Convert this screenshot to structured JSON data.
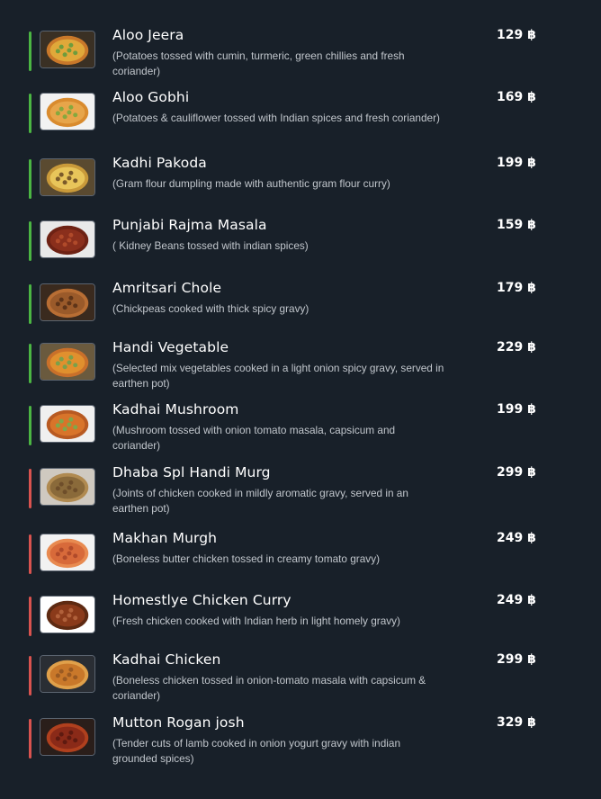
{
  "colors": {
    "background": "#182029",
    "veg": "#4bb543",
    "nonveg": "#d9534f"
  },
  "items": [
    {
      "name": "Aloo Jeera",
      "description": "(Potatoes tossed with cumin, turmeric, green chillies and fresh coriander)",
      "price": "129 ฿",
      "diet": "veg",
      "image": "aloo-jeera-photo"
    },
    {
      "name": "Aloo Gobhi",
      "description": "(Potatoes & cauliflower tossed with Indian spices and fresh coriander)",
      "price": "169 ฿",
      "diet": "veg",
      "image": "aloo-gobhi-photo"
    },
    {
      "name": "Kadhi Pakoda",
      "description": "(Gram flour dumpling made with authentic gram flour curry)",
      "price": "199 ฿",
      "diet": "veg",
      "image": "kadhi-pakoda-photo"
    },
    {
      "name": "Punjabi Rajma Masala",
      "description": "( Kidney Beans tossed with indian spices)",
      "price": "159 ฿",
      "diet": "veg",
      "image": "rajma-masala-photo"
    },
    {
      "name": "Amritsari Chole",
      "description": "(Chickpeas cooked with thick spicy gravy)",
      "price": "179 ฿",
      "diet": "veg",
      "image": "amritsari-chole-photo"
    },
    {
      "name": "Handi Vegetable",
      "description": "(Selected mix vegetables cooked in a light onion spicy gravy, served in earthen pot)",
      "price": "229 ฿",
      "diet": "veg",
      "image": "handi-vegetable-photo"
    },
    {
      "name": "Kadhai Mushroom",
      "description": "(Mushroom tossed with onion tomato masala, capsicum and coriander)",
      "price": "199 ฿",
      "diet": "veg",
      "image": "kadhai-mushroom-photo"
    },
    {
      "name": "Dhaba Spl Handi Murg",
      "description": "(Joints of chicken cooked in mildly aromatic gravy, served in an earthen pot)",
      "price": "299 ฿",
      "diet": "nonveg",
      "image": "handi-murg-photo"
    },
    {
      "name": "Makhan Murgh",
      "description": "(Boneless butter chicken tossed in creamy tomato gravy)",
      "price": "249 ฿",
      "diet": "nonveg",
      "image": "makhan-murgh-photo"
    },
    {
      "name": "Homestlye Chicken Curry",
      "description": "(Fresh chicken cooked with Indian herb in light homely gravy)",
      "price": "249 ฿",
      "diet": "nonveg",
      "image": "chicken-curry-photo"
    },
    {
      "name": "Kadhai Chicken",
      "description": "(Boneless chicken tossed in onion-tomato masala with capsicum & coriander)",
      "price": "299 ฿",
      "diet": "nonveg",
      "image": "kadhai-chicken-photo"
    },
    {
      "name": "Mutton Rogan josh",
      "description": "(Tender cuts of lamb cooked in onion yogurt gravy with indian grounded spices)",
      "price": "329 ฿",
      "diet": "nonveg",
      "image": "rogan-josh-photo"
    }
  ]
}
